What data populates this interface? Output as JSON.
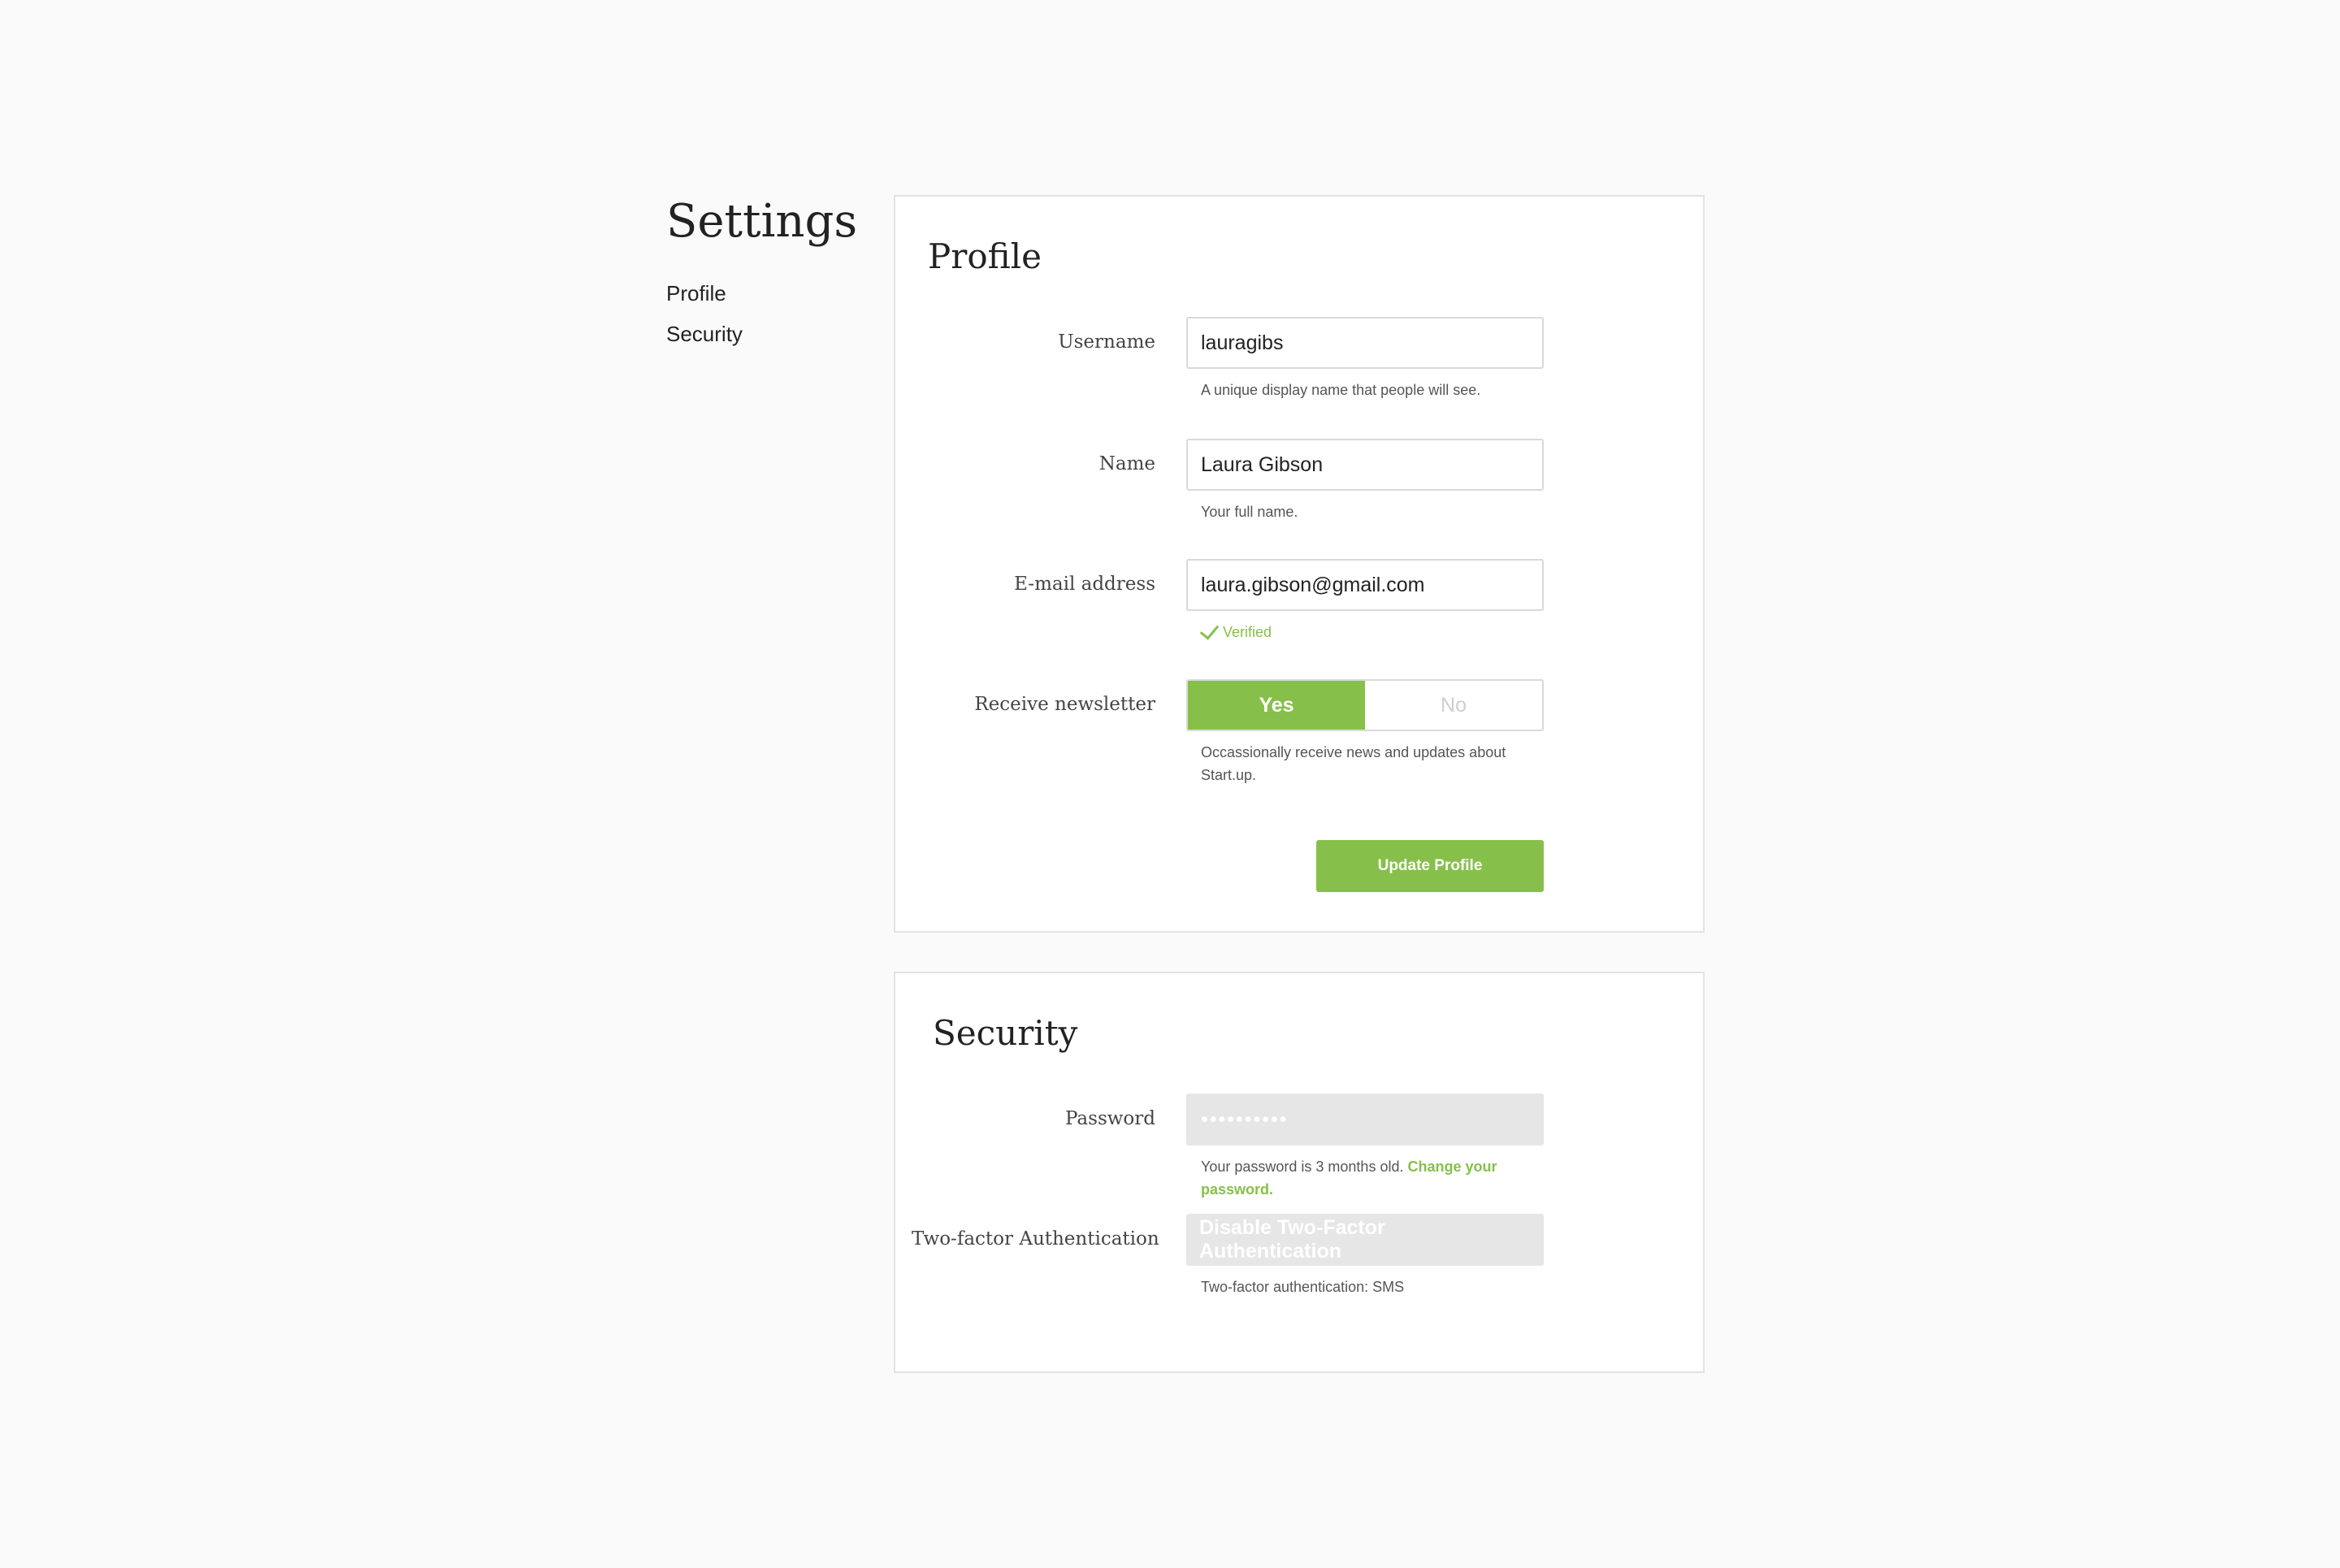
{
  "sidebar": {
    "title": "Settings",
    "items": [
      {
        "label": "Profile"
      },
      {
        "label": "Security"
      }
    ]
  },
  "profile": {
    "title": "Profile",
    "username": {
      "label": "Username",
      "value": "lauragibs",
      "help": "A unique display name that people will see."
    },
    "name": {
      "label": "Name",
      "value": "Laura Gibson",
      "help": "Your full name."
    },
    "email": {
      "label": "E-mail address",
      "value": "laura.gibson@gmail.com",
      "status": "Verified"
    },
    "newsletter": {
      "label": "Receive newsletter",
      "yes": "Yes",
      "no": "No",
      "selected": "Yes",
      "help": "Occassionally receive news and updates about Start.up."
    },
    "submit_label": "Update Profile"
  },
  "security": {
    "title": "Security",
    "password": {
      "label": "Password",
      "value": "••••••••••",
      "help_prefix": "Your password is 3 months old. ",
      "change_link": "Change your password."
    },
    "two_factor": {
      "label": "Two-factor Authentication",
      "button": "Disable Two-Factor Authentication",
      "help": "Two-factor authentication: SMS"
    }
  },
  "colors": {
    "accent": "#86c04a",
    "background": "#fafafa",
    "disabled": "#e6e6e6"
  }
}
